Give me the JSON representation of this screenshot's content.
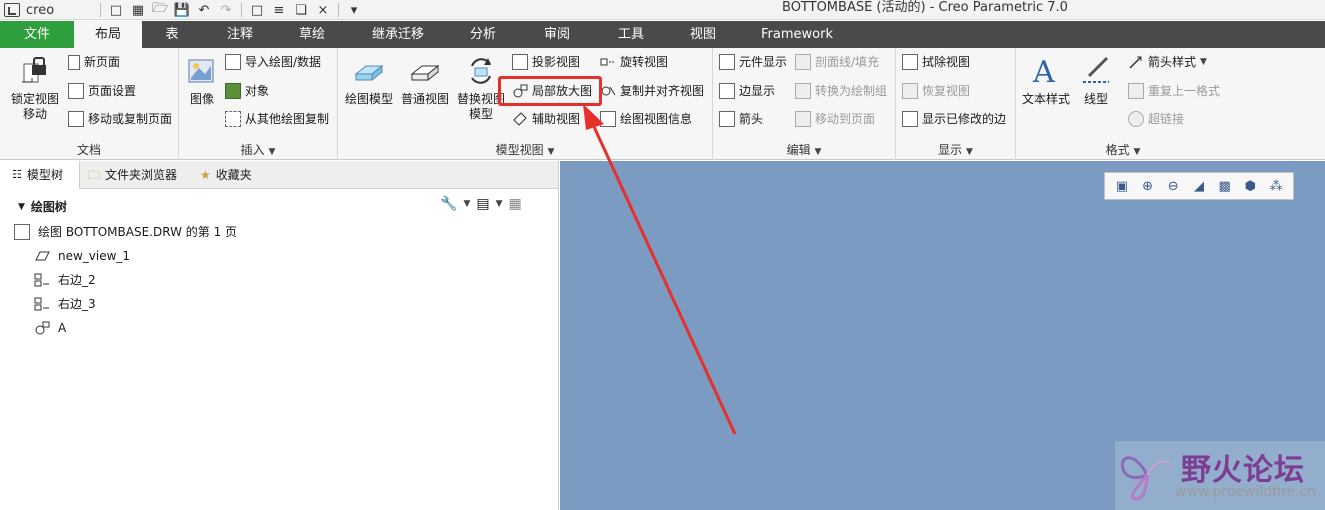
{
  "app": {
    "logo_text": "creo",
    "window_title": "BOTTOMBASE (活动的) - Creo Parametric 7.0"
  },
  "ribbon_tabs": [
    "文件",
    "布局",
    "表",
    "注释",
    "草绘",
    "继承迁移",
    "分析",
    "审阅",
    "工具",
    "视图",
    "Framework"
  ],
  "active_tab": "布局",
  "groups": {
    "document": {
      "label": "文档",
      "lock_view": "锁定视图\n移动",
      "new_page": "新页面",
      "page_setup": "页面设置",
      "move_copy_page": "移动或复制页面"
    },
    "insert": {
      "label": "插入",
      "image": "图像",
      "import_drawing": "导入绘图/数据",
      "object": "对象",
      "copy_from_drawing": "从其他绘图复制"
    },
    "model_views": {
      "label": "模型视图",
      "drawing_model": "绘图模型",
      "general_view": "普通视图",
      "replace_view_model": "替换视图\n模型",
      "projection_view": "投影视图",
      "detailed_view": "局部放大图",
      "auxiliary_view": "辅助视图",
      "revolved_view": "旋转视图",
      "copy_align_view": "复制并对齐视图",
      "drawing_view_info": "绘图视图信息"
    },
    "edit": {
      "label": "编辑",
      "element_display": "元件显示",
      "edge_display": "边显示",
      "arrow": "箭头",
      "hatch": "剖面线/填充",
      "convert_group": "转换为绘制组",
      "move_to_page": "移动到页面"
    },
    "display": {
      "label": "显示",
      "erase_view": "拭除视图",
      "resume_view": "恢复视图",
      "show_modified_edges": "显示已修改的边"
    },
    "format": {
      "label": "格式",
      "text_style": "文本样式",
      "line_style": "线型",
      "arrow_style": "箭头样式",
      "repeat_last_format": "重复上一格式",
      "hyperlink": "超链接"
    }
  },
  "panel": {
    "tabs": [
      "模型树",
      "文件夹浏览器",
      "收藏夹"
    ],
    "tree_title": "绘图树",
    "tree": {
      "root": "绘图 BOTTOMBASE.DRW 的第 1 页",
      "items": [
        "new_view_1",
        "右边_2",
        "右边_3",
        "A"
      ]
    }
  },
  "watermark": {
    "title": "野火论坛",
    "url": "www.proewildfire.cn"
  },
  "colors": {
    "file_tab": "#2f9e3c",
    "tab_bar": "#4a4a4a",
    "canvas": "#7c9bc2",
    "annotation": "#e6302b"
  }
}
